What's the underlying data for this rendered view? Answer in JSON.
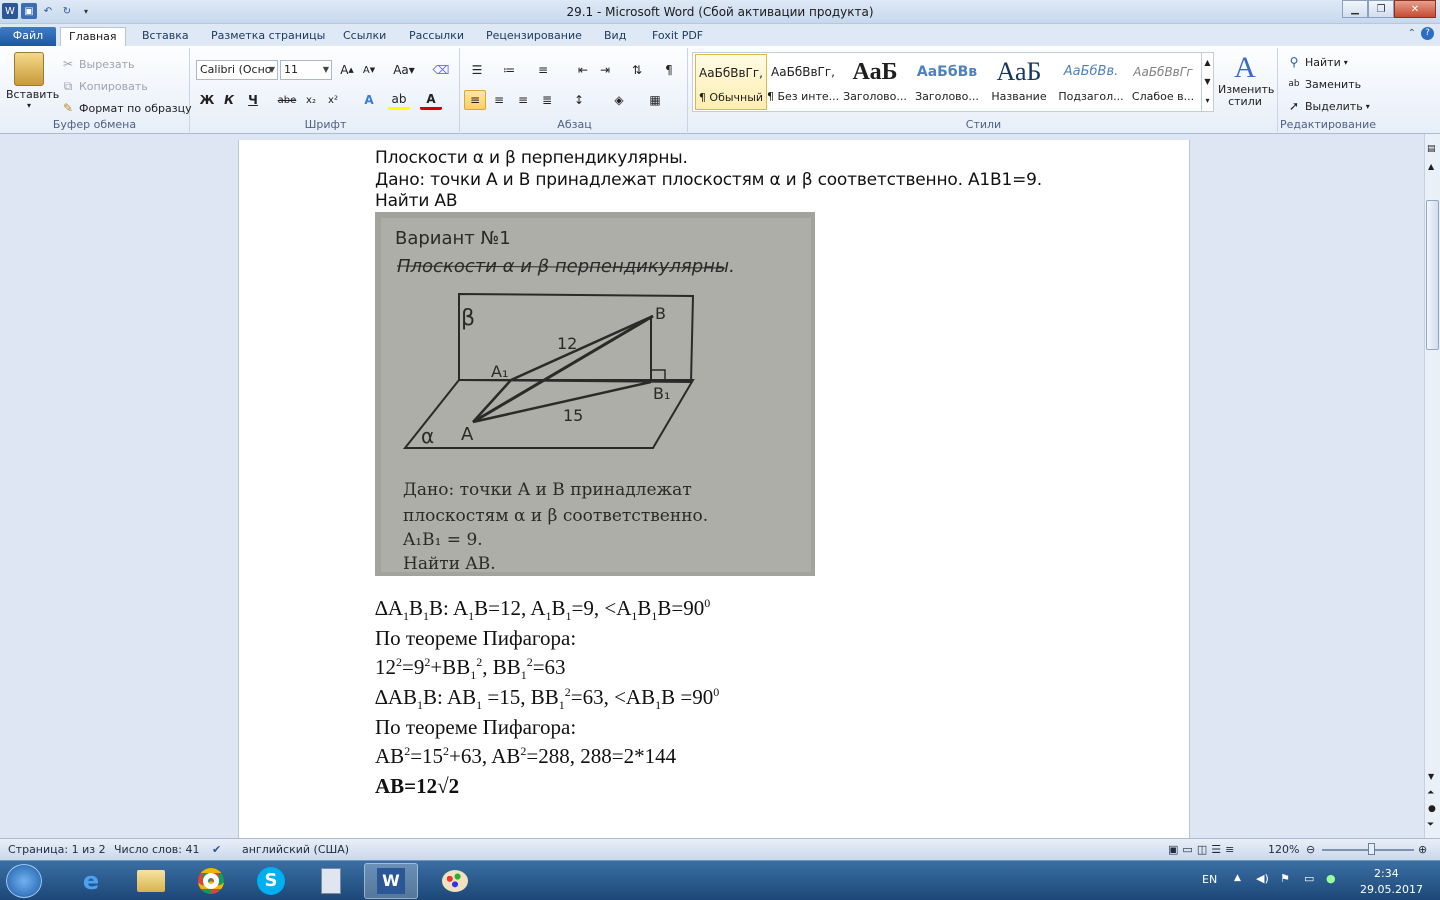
{
  "window": {
    "title": "29.1  -  Microsoft Word (Сбой активации продукта)"
  },
  "tabs": [
    {
      "label": "Файл"
    },
    {
      "label": "Главная"
    },
    {
      "label": "Вставка"
    },
    {
      "label": "Разметка страницы"
    },
    {
      "label": "Ссылки"
    },
    {
      "label": "Рассылки"
    },
    {
      "label": "Рецензирование"
    },
    {
      "label": "Вид"
    },
    {
      "label": "Foxit PDF"
    }
  ],
  "clipboard": {
    "paste": "Вставить",
    "cut": "Вырезать",
    "copy": "Копировать",
    "format": "Формат по образцу",
    "label": "Буфер обмена"
  },
  "font": {
    "name": "Calibri (Осно",
    "size": "11",
    "label": "Шрифт",
    "bold": "Ж",
    "italic": "К",
    "underline": "Ч",
    "strike": "abe",
    "sub": "x₂",
    "sup": "x²"
  },
  "paragraph": {
    "label": "Абзац"
  },
  "styles": {
    "label": "Стили",
    "items": [
      {
        "preview": "АаБбВвГг,",
        "name": "¶ Обычный"
      },
      {
        "preview": "АаБбВвГг,",
        "name": "¶ Без инте..."
      },
      {
        "preview": "АаБ",
        "name": "Заголово..."
      },
      {
        "preview": "АаБбВв",
        "name": "Заголово..."
      },
      {
        "preview": "АаБ",
        "name": "Название"
      },
      {
        "preview": "АаБбВв.",
        "name": "Подзагол..."
      },
      {
        "preview": "АаБбВвГг",
        "name": "Слабое в..."
      }
    ],
    "change": "Изменить стили"
  },
  "editing": {
    "find": "Найти",
    "replace": "Заменить",
    "select": "Выделить",
    "label": "Редактирование"
  },
  "doc": {
    "line1": "Плоскости α и β перпендикулярны.",
    "line2": "Дано: точки А и В принадлежат плоскостям α и β соответственно. A1B1=9.",
    "line3": "Найти АВ",
    "photo": {
      "variant": "Вариант №1",
      "heading": "Плоскости α и β перпендикулярны.",
      "beta": "β",
      "alpha": "α",
      "a": "A",
      "a1": "A₁",
      "b": "B",
      "b1": "B₁",
      "len12": "12",
      "len15": "15",
      "given1": "Дано: точки A и B принадлежат",
      "given2": "плоскостям α и β соответственно.",
      "given3": "A₁B₁ = 9.",
      "given4": "Найти AB."
    }
  },
  "status": {
    "page": "Страница: 1 из 2",
    "words": "Число слов: 41",
    "lang": "английский (США)",
    "zoom": "120%"
  },
  "tray": {
    "lang": "EN",
    "time": "2:34",
    "date": "29.05.2017"
  }
}
